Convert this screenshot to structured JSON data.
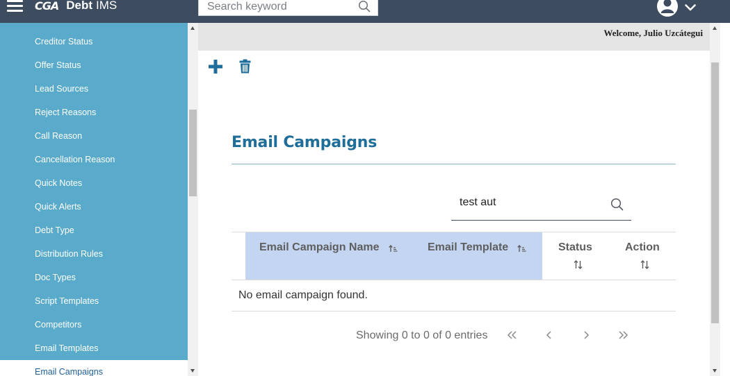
{
  "topbar": {
    "logo_text": "CGA",
    "app_name": "Debt",
    "app_name_suffix": "IMS",
    "search_placeholder": "Search keyword"
  },
  "sidebar": {
    "items": [
      {
        "label": "Creditor Status"
      },
      {
        "label": "Offer Status"
      },
      {
        "label": "Lead Sources"
      },
      {
        "label": "Reject Reasons"
      },
      {
        "label": "Call Reason"
      },
      {
        "label": "Cancellation Reason"
      },
      {
        "label": "Quick Notes"
      },
      {
        "label": "Quick Alerts"
      },
      {
        "label": "Debt Type"
      },
      {
        "label": "Distribution Rules"
      },
      {
        "label": "Doc Types"
      },
      {
        "label": "Script Templates"
      },
      {
        "label": "Competitors"
      },
      {
        "label": "Email Templates"
      },
      {
        "label": "Email Campaigns",
        "active": true
      }
    ]
  },
  "header": {
    "welcome": "Welcome, Julio Uzcátegui"
  },
  "toolbar": {
    "add_icon": "plus-icon",
    "delete_icon": "trash-icon"
  },
  "main": {
    "title": "Email Campaigns",
    "filter_value": "test aut",
    "table": {
      "columns": [
        {
          "label": "Email Campaign Name",
          "sorted": true
        },
        {
          "label": "Email Template",
          "sorted": true
        },
        {
          "label": "Status",
          "sorted": false
        },
        {
          "label": "Action",
          "sorted": false
        }
      ],
      "empty_message": "No email campaign found."
    },
    "paging": {
      "info": "Showing 0 to 0 of 0 entries",
      "first": "«",
      "prev": "‹",
      "next": "›",
      "last": "»"
    }
  },
  "colors": {
    "topbar": "#3d4c5e",
    "sidebar": "#5aabcb",
    "accent": "#1f6e9a",
    "sorted_header": "#c3d5f0"
  }
}
